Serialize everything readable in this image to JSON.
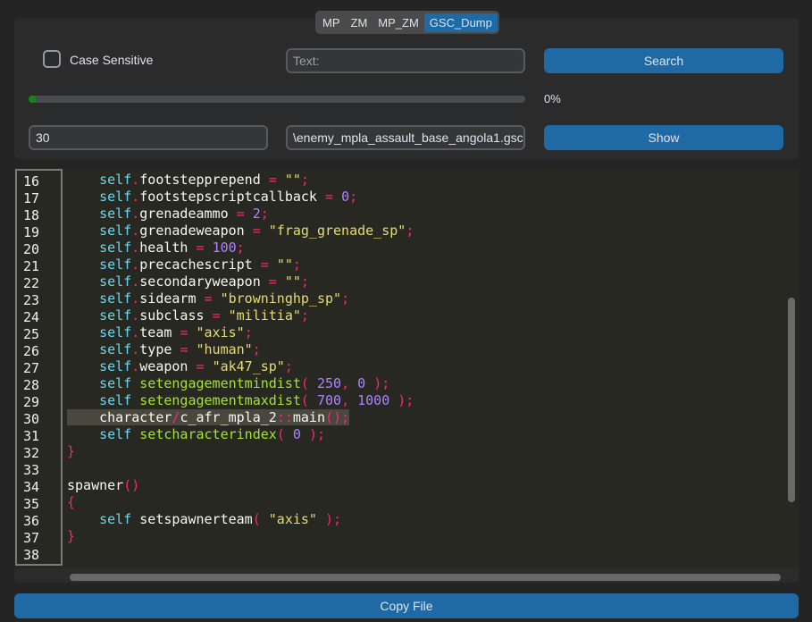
{
  "tabs": [
    {
      "label": "MP",
      "active": false
    },
    {
      "label": "ZM",
      "active": false
    },
    {
      "label": "MP_ZM",
      "active": false
    },
    {
      "label": "GSC_Dump",
      "active": true
    }
  ],
  "search": {
    "case_sensitive_label": "Case Sensitive",
    "case_sensitive_checked": false,
    "text_placeholder": "Text:",
    "text_value": "",
    "search_label": "Search"
  },
  "progress": {
    "value_percent": 0,
    "label": "0%",
    "color": "#108a10"
  },
  "show": {
    "line_value": "30",
    "file_value": "\\enemy_mpla_assault_base_angola1.gsc",
    "show_label": "Show"
  },
  "editor": {
    "highlighted_line": 30,
    "lines": [
      {
        "n": "16",
        "tokens": [
          [
            "    ",
            "d"
          ],
          [
            "self",
            "s"
          ],
          [
            ".",
            "p"
          ],
          [
            "footstepprepend ",
            "d"
          ],
          [
            "=",
            "p"
          ],
          [
            " ",
            "d"
          ],
          [
            "\"\"",
            "t"
          ],
          [
            ";",
            "p"
          ]
        ]
      },
      {
        "n": "17",
        "tokens": [
          [
            "    ",
            "d"
          ],
          [
            "self",
            "s"
          ],
          [
            ".",
            "p"
          ],
          [
            "footstepscriptcallback ",
            "d"
          ],
          [
            "=",
            "p"
          ],
          [
            " ",
            "d"
          ],
          [
            "0",
            "n"
          ],
          [
            ";",
            "p"
          ]
        ]
      },
      {
        "n": "18",
        "tokens": [
          [
            "    ",
            "d"
          ],
          [
            "self",
            "s"
          ],
          [
            ".",
            "p"
          ],
          [
            "grenadeammo ",
            "d"
          ],
          [
            "=",
            "p"
          ],
          [
            " ",
            "d"
          ],
          [
            "2",
            "n"
          ],
          [
            ";",
            "p"
          ]
        ]
      },
      {
        "n": "19",
        "tokens": [
          [
            "    ",
            "d"
          ],
          [
            "self",
            "s"
          ],
          [
            ".",
            "p"
          ],
          [
            "grenadeweapon ",
            "d"
          ],
          [
            "=",
            "p"
          ],
          [
            " ",
            "d"
          ],
          [
            "\"frag_grenade_sp\"",
            "t"
          ],
          [
            ";",
            "p"
          ]
        ]
      },
      {
        "n": "20",
        "tokens": [
          [
            "    ",
            "d"
          ],
          [
            "self",
            "s"
          ],
          [
            ".",
            "p"
          ],
          [
            "health ",
            "d"
          ],
          [
            "=",
            "p"
          ],
          [
            " ",
            "d"
          ],
          [
            "100",
            "n"
          ],
          [
            ";",
            "p"
          ]
        ]
      },
      {
        "n": "21",
        "tokens": [
          [
            "    ",
            "d"
          ],
          [
            "self",
            "s"
          ],
          [
            ".",
            "p"
          ],
          [
            "precachescript ",
            "d"
          ],
          [
            "=",
            "p"
          ],
          [
            " ",
            "d"
          ],
          [
            "\"\"",
            "t"
          ],
          [
            ";",
            "p"
          ]
        ]
      },
      {
        "n": "22",
        "tokens": [
          [
            "    ",
            "d"
          ],
          [
            "self",
            "s"
          ],
          [
            ".",
            "p"
          ],
          [
            "secondaryweapon ",
            "d"
          ],
          [
            "=",
            "p"
          ],
          [
            " ",
            "d"
          ],
          [
            "\"\"",
            "t"
          ],
          [
            ";",
            "p"
          ]
        ]
      },
      {
        "n": "23",
        "tokens": [
          [
            "    ",
            "d"
          ],
          [
            "self",
            "s"
          ],
          [
            ".",
            "p"
          ],
          [
            "sidearm ",
            "d"
          ],
          [
            "=",
            "p"
          ],
          [
            " ",
            "d"
          ],
          [
            "\"browninghp_sp\"",
            "t"
          ],
          [
            ";",
            "p"
          ]
        ]
      },
      {
        "n": "24",
        "tokens": [
          [
            "    ",
            "d"
          ],
          [
            "self",
            "s"
          ],
          [
            ".",
            "p"
          ],
          [
            "subclass ",
            "d"
          ],
          [
            "=",
            "p"
          ],
          [
            " ",
            "d"
          ],
          [
            "\"militia\"",
            "t"
          ],
          [
            ";",
            "p"
          ]
        ]
      },
      {
        "n": "25",
        "tokens": [
          [
            "    ",
            "d"
          ],
          [
            "self",
            "s"
          ],
          [
            ".",
            "p"
          ],
          [
            "team ",
            "d"
          ],
          [
            "=",
            "p"
          ],
          [
            " ",
            "d"
          ],
          [
            "\"axis\"",
            "t"
          ],
          [
            ";",
            "p"
          ]
        ]
      },
      {
        "n": "26",
        "tokens": [
          [
            "    ",
            "d"
          ],
          [
            "self",
            "s"
          ],
          [
            ".",
            "p"
          ],
          [
            "type ",
            "d"
          ],
          [
            "=",
            "p"
          ],
          [
            " ",
            "d"
          ],
          [
            "\"human\"",
            "t"
          ],
          [
            ";",
            "p"
          ]
        ]
      },
      {
        "n": "27",
        "tokens": [
          [
            "    ",
            "d"
          ],
          [
            "self",
            "s"
          ],
          [
            ".",
            "p"
          ],
          [
            "weapon ",
            "d"
          ],
          [
            "=",
            "p"
          ],
          [
            " ",
            "d"
          ],
          [
            "\"ak47_sp\"",
            "t"
          ],
          [
            ";",
            "p"
          ]
        ]
      },
      {
        "n": "28",
        "tokens": [
          [
            "    ",
            "d"
          ],
          [
            "self ",
            "s"
          ],
          [
            "setengagementmindist",
            "f"
          ],
          [
            "(",
            "p"
          ],
          [
            " ",
            "d"
          ],
          [
            "250",
            "n"
          ],
          [
            ",",
            "p"
          ],
          [
            " ",
            "d"
          ],
          [
            "0",
            "n"
          ],
          [
            " ",
            "d"
          ],
          [
            ");",
            "p"
          ]
        ]
      },
      {
        "n": "29",
        "tokens": [
          [
            "    ",
            "d"
          ],
          [
            "self ",
            "s"
          ],
          [
            "setengagementmaxdist",
            "f"
          ],
          [
            "(",
            "p"
          ],
          [
            " ",
            "d"
          ],
          [
            "700",
            "n"
          ],
          [
            ",",
            "p"
          ],
          [
            " ",
            "d"
          ],
          [
            "1000",
            "n"
          ],
          [
            " ",
            "d"
          ],
          [
            ");",
            "p"
          ]
        ]
      },
      {
        "n": "30",
        "tokens": [
          [
            "    character",
            "d"
          ],
          [
            "/",
            "p"
          ],
          [
            "c_afr_mpla_2",
            "d"
          ],
          [
            "::",
            "p"
          ],
          [
            "main",
            "d"
          ],
          [
            "();",
            "p"
          ]
        ]
      },
      {
        "n": "31",
        "tokens": [
          [
            "    ",
            "d"
          ],
          [
            "self ",
            "s"
          ],
          [
            "setcharacterindex",
            "f"
          ],
          [
            "(",
            "p"
          ],
          [
            " ",
            "d"
          ],
          [
            "0",
            "n"
          ],
          [
            " ",
            "d"
          ],
          [
            ");",
            "p"
          ]
        ]
      },
      {
        "n": "32",
        "tokens": [
          [
            "}",
            "p"
          ]
        ]
      },
      {
        "n": "33",
        "tokens": []
      },
      {
        "n": "34",
        "tokens": [
          [
            "spawner",
            "d"
          ],
          [
            "()",
            "p"
          ]
        ]
      },
      {
        "n": "35",
        "tokens": [
          [
            "{",
            "p"
          ]
        ]
      },
      {
        "n": "36",
        "tokens": [
          [
            "    ",
            "d"
          ],
          [
            "self ",
            "s"
          ],
          [
            "setspawnerteam",
            "d"
          ],
          [
            "(",
            "p"
          ],
          [
            " ",
            "d"
          ],
          [
            "\"axis\"",
            "t"
          ],
          [
            " ",
            "d"
          ],
          [
            ");",
            "p"
          ]
        ]
      },
      {
        "n": "37",
        "tokens": [
          [
            "}",
            "p"
          ]
        ]
      },
      {
        "n": "38",
        "tokens": []
      }
    ]
  },
  "footer": {
    "copy_label": "Copy File"
  },
  "colors": {
    "accent": "#1f6aa5",
    "background": "#242424",
    "panel": "#2b2b2b",
    "editor_bg": "#272822"
  }
}
